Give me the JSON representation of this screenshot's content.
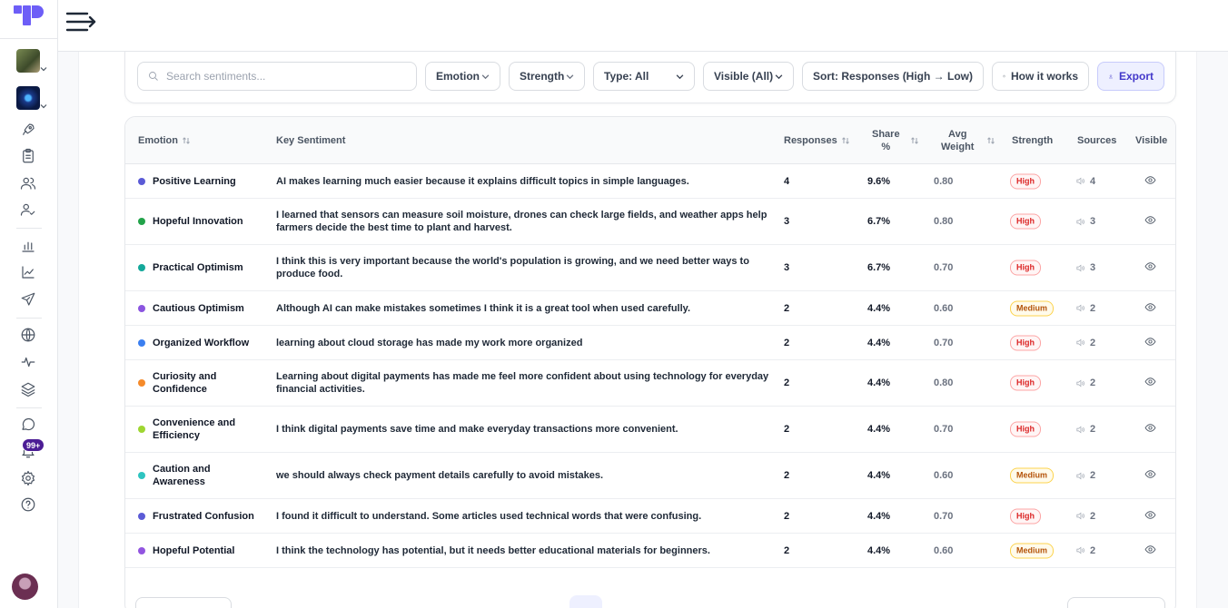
{
  "colors": {
    "accent": "#4338ca",
    "logo": "#6d5ef7",
    "high": "#dc2626",
    "medium": "#b45309"
  },
  "sidebar": {
    "badge": "99+",
    "icons": [
      "rocket-icon",
      "clipboard-icon",
      "users-icon",
      "user-check-icon",
      "bar-chart-icon",
      "line-chart-icon",
      "send-icon",
      "globe-icon",
      "activity-icon",
      "layers-icon",
      "chat-icon",
      "bell-icon",
      "gear-icon",
      "help-icon"
    ]
  },
  "filters": {
    "search_placeholder": "Search sentiments...",
    "emotion": "Emotion",
    "strength": "Strength",
    "type": "Type: All",
    "visible": "Visible (All)",
    "sort": "Sort: Responses (High → Low)",
    "how": "How it works",
    "export": "Export"
  },
  "table": {
    "headers": {
      "emotion": "Emotion",
      "key": "Key Sentiment",
      "responses": "Responses",
      "share_1": "Share",
      "share_2": "%",
      "avg_1": "Avg",
      "avg_2": "Weight",
      "strength": "Strength",
      "sources": "Sources",
      "visible": "Visible"
    },
    "rows": [
      {
        "emotion": "Positive Learning",
        "dot": "#5b5bd6",
        "sentiment": "AI makes learning much easier because it explains difficult topics in simple languages.",
        "responses": "4",
        "share": "9.6%",
        "avg": "0.80",
        "strength": "High",
        "sources": "4"
      },
      {
        "emotion": "Hopeful Innovation",
        "dot": "#22a34a",
        "sentiment": "I learned that sensors can measure soil moisture, drones can check large fields, and weather apps help farmers decide the best time to plant and harvest.",
        "responses": "3",
        "share": "6.7%",
        "avg": "0.80",
        "strength": "High",
        "sources": "3"
      },
      {
        "emotion": "Practical Optimism",
        "dot": "#14a89a",
        "sentiment": "I think this is very important because the world's population is growing, and we need better ways to produce food.",
        "responses": "3",
        "share": "6.7%",
        "avg": "0.70",
        "strength": "High",
        "sources": "3"
      },
      {
        "emotion": "Cautious Optimism",
        "dot": "#8b55e0",
        "sentiment": "Although AI can make mistakes sometimes I think it is a great tool when used carefully.",
        "responses": "2",
        "share": "4.4%",
        "avg": "0.60",
        "strength": "Medium",
        "sources": "2"
      },
      {
        "emotion": "Organized Workflow",
        "dot": "#3b7ff0",
        "sentiment": "learning about cloud storage has made my work more organized",
        "responses": "2",
        "share": "4.4%",
        "avg": "0.70",
        "strength": "High",
        "sources": "2"
      },
      {
        "emotion": "Curiosity and Confidence",
        "dot": "#f58a2a",
        "sentiment": "Learning about digital payments has made me feel more confident about using technology for everyday financial activities.",
        "responses": "2",
        "share": "4.4%",
        "avg": "0.80",
        "strength": "High",
        "sources": "2"
      },
      {
        "emotion": "Convenience and Efficiency",
        "dot": "#9ed631",
        "sentiment": "I think digital payments save time and make everyday transactions more convenient.",
        "responses": "2",
        "share": "4.4%",
        "avg": "0.70",
        "strength": "High",
        "sources": "2"
      },
      {
        "emotion": "Caution and Awareness",
        "dot": "#2ec4c0",
        "sentiment": "we should always check payment details carefully to avoid mistakes.",
        "responses": "2",
        "share": "4.4%",
        "avg": "0.60",
        "strength": "Medium",
        "sources": "2"
      },
      {
        "emotion": "Frustrated Confusion",
        "dot": "#5b5bd6",
        "sentiment": "I found it difficult to understand. Some articles used technical words that were confusing.",
        "responses": "2",
        "share": "4.4%",
        "avg": "0.70",
        "strength": "High",
        "sources": "2"
      },
      {
        "emotion": "Hopeful Potential",
        "dot": "#9255e0",
        "sentiment": "I think the technology has potential, but it needs better educational materials for beginners.",
        "responses": "2",
        "share": "4.4%",
        "avg": "0.60",
        "strength": "Medium",
        "sources": "2"
      }
    ]
  }
}
